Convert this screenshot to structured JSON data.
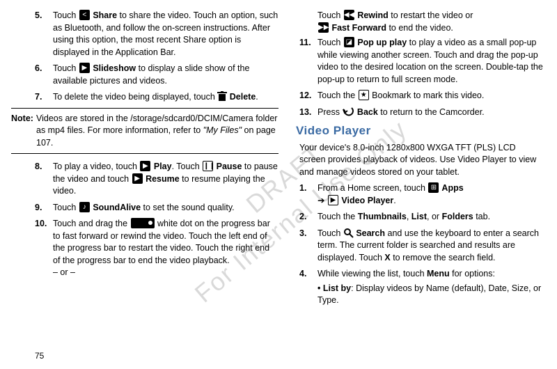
{
  "left": {
    "s5n": "5.",
    "s5a": "Touch ",
    "s5b": " Share",
    "s5c": " to share the video. Touch an option, such as Bluetooth, and follow the on-screen instructions. After using this option, the most recent Share option is displayed in the Application Bar.",
    "s6n": "6.",
    "s6a": "Touch ",
    "s6b": " Slideshow",
    "s6c": " to display a slide show of the available pictures and videos.",
    "s7n": "7.",
    "s7a": "To delete the video being displayed, touch ",
    "s7b": " Delete",
    "s7c": ".",
    "noteL": "Note:",
    "note1": "Videos are stored in the /storage/sdcard0/DCIM/Camera folder as mp4 files. For more information, refer to ",
    "noteI": "\"My Files\"",
    "note2": " on page 107.",
    "s8n": "8.",
    "s8a": "To play a video, touch ",
    "s8b": " Play",
    "s8c": ". Touch ",
    "s8d": " Pause",
    "s8e": " to pause the video and touch ",
    "s8f": " Resume",
    "s8g": " to resume playing the video.",
    "s9n": "9.",
    "s9a": "Touch ",
    "s9b": " SoundAlive",
    "s9c": " to set the sound quality.",
    "s10n": "10.",
    "s10a": "Touch and drag the ",
    "s10b": " white dot on the progress bar to fast forward or rewind the video. Touch the left end of the progress bar to restart the video. Touch the right end of the progress bar to end the video playback.",
    "s10or": "– or –"
  },
  "right": {
    "r0a": "Touch ",
    "r0b": " Rewind",
    "r0c": " to restart the video or",
    "r0d": " Fast Forward",
    "r0e": " to end the video.",
    "s11n": "11.",
    "s11a": "Touch ",
    "s11b": " Pop up play",
    "s11c": " to play a video as a small pop-up while viewing another screen. Touch and drag the pop-up video to the desired location on the screen. Double-tap the pop-up to return to full screen mode.",
    "s12n": "12.",
    "s12a": "Touch the ",
    "s12b": " Bookmark to mark this video.",
    "s13n": "13.",
    "s13a": "Press ",
    "s13b": " Back",
    "s13c": " to return to the Camcorder.",
    "head": "Video Player",
    "intro": "Your device's 8.0-inch 1280x800 WXGA TFT (PLS) LCD screen provides playback of videos. Use Video Player to view and manage videos stored on your tablet.",
    "r1n": "1.",
    "r1a": "From a Home screen, touch ",
    "r1b": " Apps",
    "r1c": "➔ ",
    "r1d": " Video Player",
    "r1e": ".",
    "r2n": "2.",
    "r2a": "Touch the ",
    "r2b": "Thumbnails",
    "r2c": ", ",
    "r2d": "List",
    "r2e": ", or ",
    "r2f": "Folders",
    "r2g": " tab.",
    "r3n": "3.",
    "r3a": "Touch ",
    "r3b": " Search",
    "r3c": " and use the keyboard to enter a search term. The current folder is searched and results are displayed. Touch ",
    "r3d": "X",
    "r3e": " to remove the search field.",
    "r4n": "4.",
    "r4a": "While viewing the list, touch ",
    "r4b": "Menu",
    "r4c": " for options:",
    "r4li": "• List by",
    "r4li2": ": Display videos by Name (default), Date, Size, or Type."
  },
  "page": "75",
  "wm1": "DRAFT",
  "wm2": "For Internal Use Only"
}
